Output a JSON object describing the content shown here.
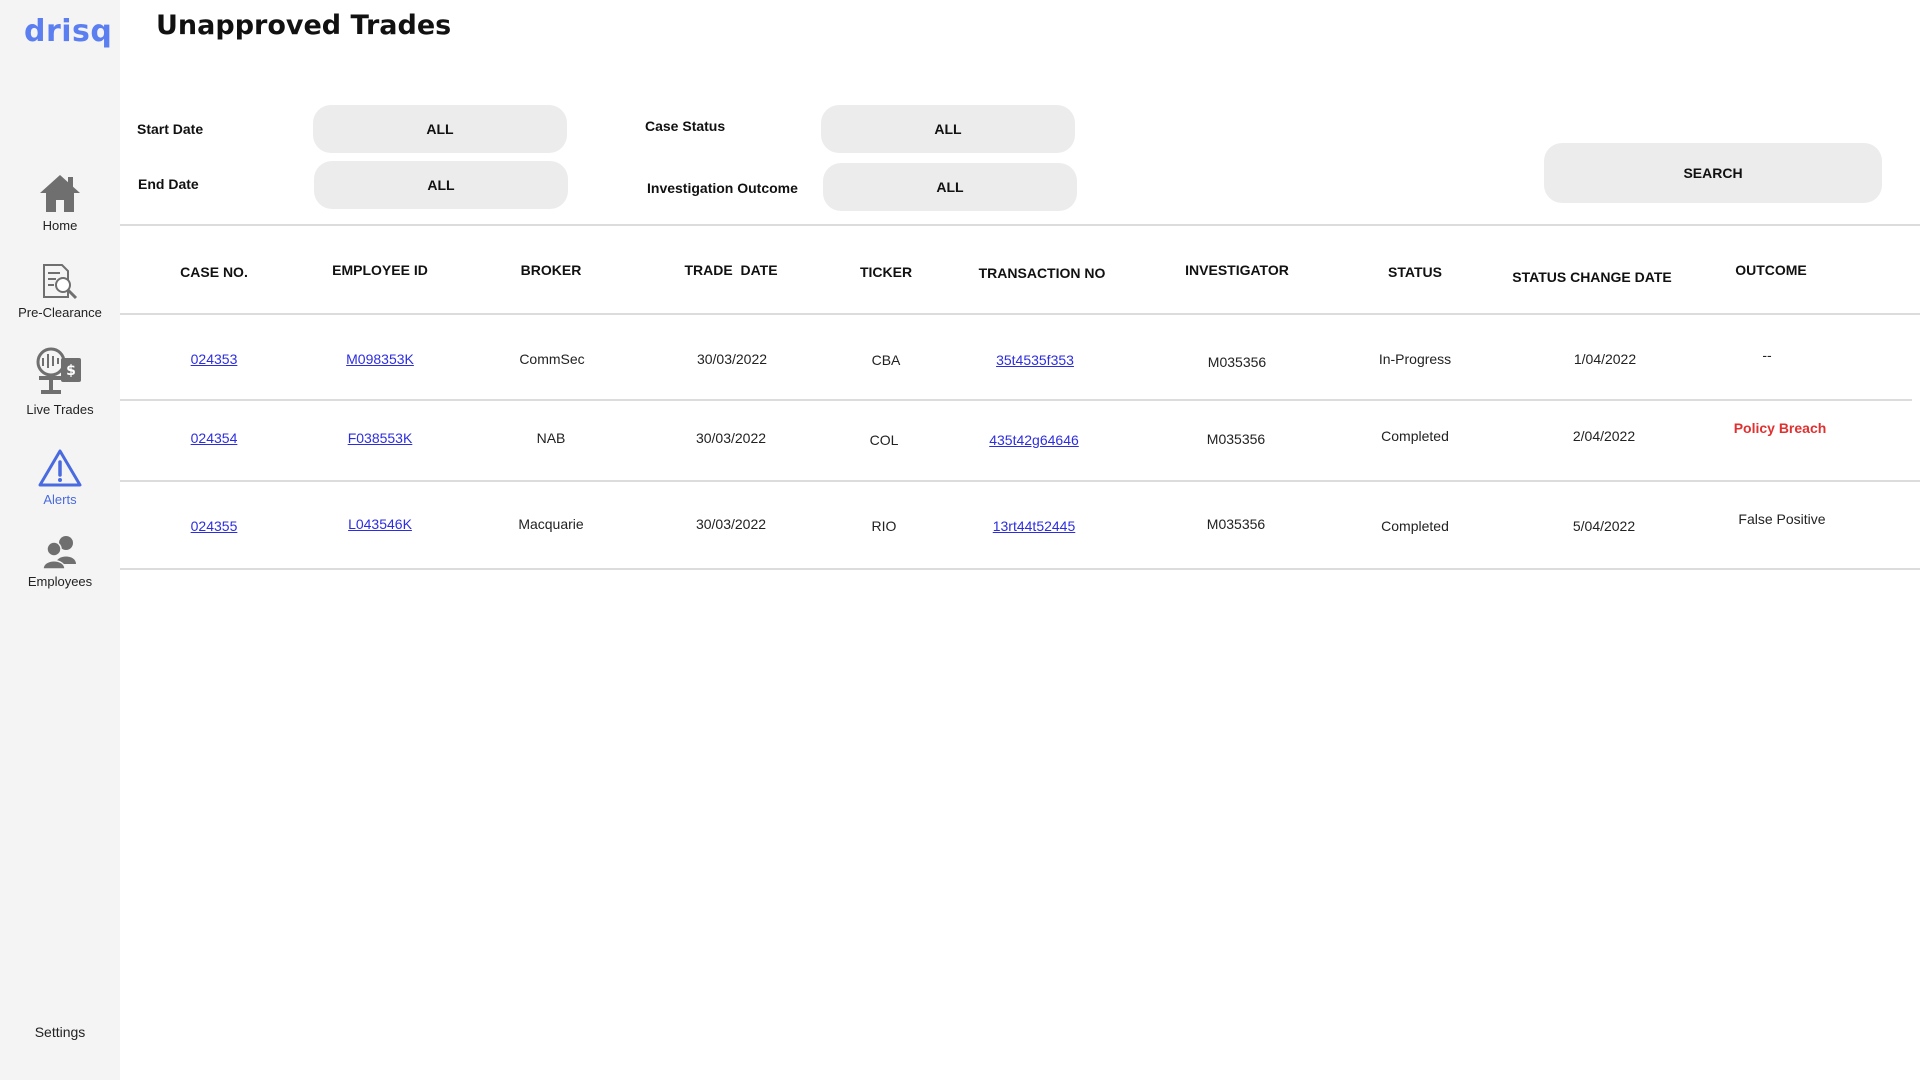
{
  "app": {
    "logo": "drisq"
  },
  "sidebar": {
    "items": [
      {
        "label": "Home",
        "icon": "home-icon"
      },
      {
        "label": "Pre-Clearance",
        "icon": "document-search-icon"
      },
      {
        "label": "Live Trades",
        "icon": "trading-monitor-icon"
      },
      {
        "label": "Alerts",
        "icon": "warning-icon",
        "active": true
      },
      {
        "label": "Employees",
        "icon": "users-icon"
      }
    ],
    "settings_label": "Settings"
  },
  "page": {
    "title": "Unapproved Trades"
  },
  "filters": {
    "start_date": {
      "label": "Start Date",
      "value": "ALL"
    },
    "end_date": {
      "label": "End Date",
      "value": "ALL"
    },
    "case_status": {
      "label": "Case Status",
      "value": "ALL"
    },
    "investigation_outcome": {
      "label": "Investigation Outcome",
      "value": "ALL"
    },
    "search_label": "SEARCH"
  },
  "table": {
    "headers": {
      "case_no": "CASE NO.",
      "employee_id": "EMPLOYEE ID",
      "broker": "BROKER",
      "trade_date": "TRADE  DATE",
      "ticker": "TICKER",
      "transaction_no": "TRANSACTION NO",
      "investigator": "INVESTIGATOR",
      "status": "STATUS",
      "status_change_date": "STATUS CHANGE DATE",
      "outcome": "OUTCOME"
    },
    "rows": [
      {
        "case_no": "024353",
        "employee_id": "M098353K",
        "broker": "CommSec",
        "trade_date": "30/03/2022",
        "ticker": "CBA",
        "transaction_no": "35t4535f353",
        "investigator": "M035356",
        "status": "In-Progress",
        "status_change_date": "1/04/2022",
        "outcome": "--"
      },
      {
        "case_no": "024354",
        "employee_id": "F038553K",
        "broker": "NAB",
        "trade_date": "30/03/2022",
        "ticker": "COL",
        "transaction_no": "435t42g64646",
        "investigator": "M035356",
        "status": "Completed",
        "status_change_date": "2/04/2022",
        "outcome": "Policy Breach"
      },
      {
        "case_no": "024355",
        "employee_id": "L043546K",
        "broker": "Macquarie",
        "trade_date": "30/03/2022",
        "ticker": "RIO",
        "transaction_no": "13rt44t52445",
        "investigator": "M035356",
        "status": "Completed",
        "status_change_date": "5/04/2022",
        "outcome": "False Positive"
      }
    ]
  },
  "colors": {
    "brand": "#5b7ff0",
    "link": "#2d2de0",
    "breach": "#e03131",
    "sidebar_bg": "#f4f4f4",
    "pill_bg": "#ececec"
  }
}
